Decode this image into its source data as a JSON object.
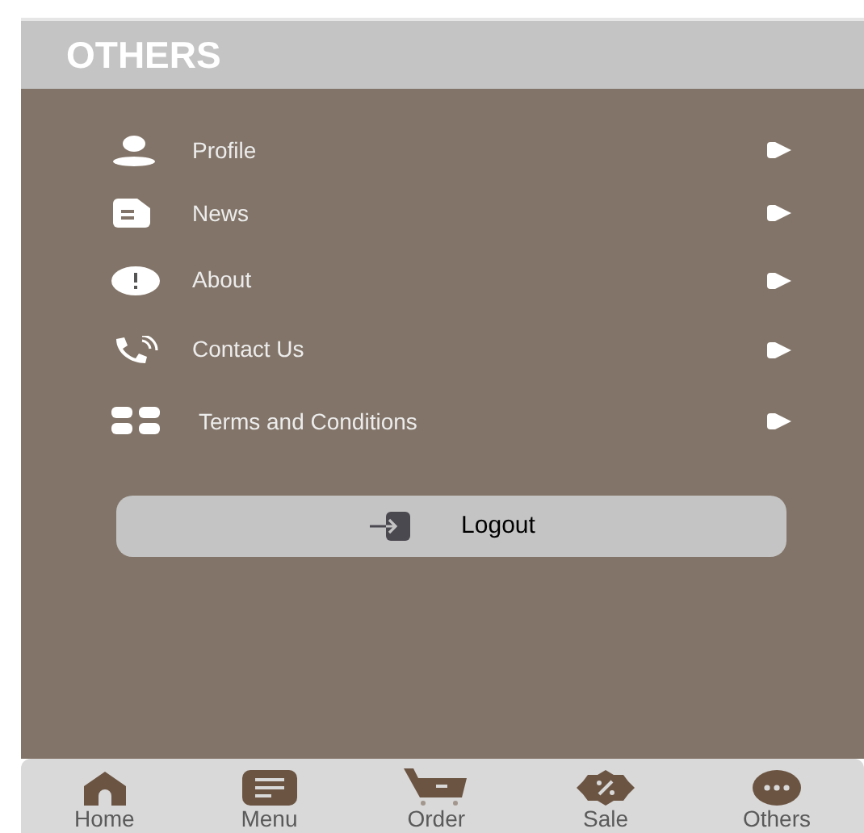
{
  "header": {
    "title": "OTHERS"
  },
  "menu_items": [
    {
      "label": "Profile"
    },
    {
      "label": "News"
    },
    {
      "label": "About"
    },
    {
      "label": "Contact Us"
    },
    {
      "label": "Terms and Conditions"
    }
  ],
  "logout_button": {
    "label": "Logout"
  },
  "bottom_nav": [
    {
      "label": "Home"
    },
    {
      "label": "Menu"
    },
    {
      "label": "Order"
    },
    {
      "label": "Sale"
    },
    {
      "label": "Others"
    }
  ]
}
